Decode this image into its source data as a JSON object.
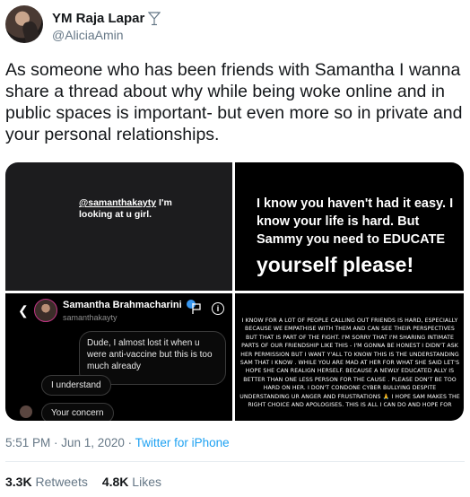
{
  "author": {
    "name": "YM Raja Lapar",
    "handle": "@AliciaAmin",
    "badge_icon": "cocktail-glass-icon"
  },
  "tweet": {
    "text": "As someone who has been friends with Samantha I wanna share a thread about why while being woke online and in public spaces is important- but even more so in private and your personal relationships."
  },
  "media": {
    "panel1": {
      "mention": "@samanthakayty",
      "text_after": " I'm",
      "line2": "looking at u girl."
    },
    "panel2": {
      "text": "I know you haven't had it easy. I know your life is hard. But Sammy you need to EDUCATE",
      "big_text": "yourself please!"
    },
    "panel3": {
      "contact_name": "Samantha Brahmacharini",
      "contact_username": "samanthakayty",
      "message_sent": "Dude, I almost lost it when u were anti-vaccine but this is too much already",
      "message_reply_1": "I understand",
      "message_reply_2": "Your concern"
    },
    "panel4": {
      "text": "I know for a lot of people calling out friends is hard, especially because we empathise with them and can see their perspectives but that is part of the fight. I'm sorry that I'm sharing intimate parts of our friendship like this - I'm gonna be honest I didn't ask her permission but I want y'all to know this is the understanding Sam that I know . While you are mad at her for what she said let's hope she can realign herself. Because a newly educated ally is better than one less person for the cause . Please don't be too hard on her. I don't condone cyber bullying despite understanding ur anger and frustrations 🙏 I hope Sam makes the right choice and apologises. This is all I can do and hope for"
    }
  },
  "meta": {
    "time": "5:51 PM",
    "sep": " · ",
    "date": "Jun 1, 2020",
    "source": "Twitter for iPhone"
  },
  "stats": {
    "retweets_count": "3.3K",
    "retweets_label": "Retweets",
    "likes_count": "4.8K",
    "likes_label": "Likes"
  }
}
